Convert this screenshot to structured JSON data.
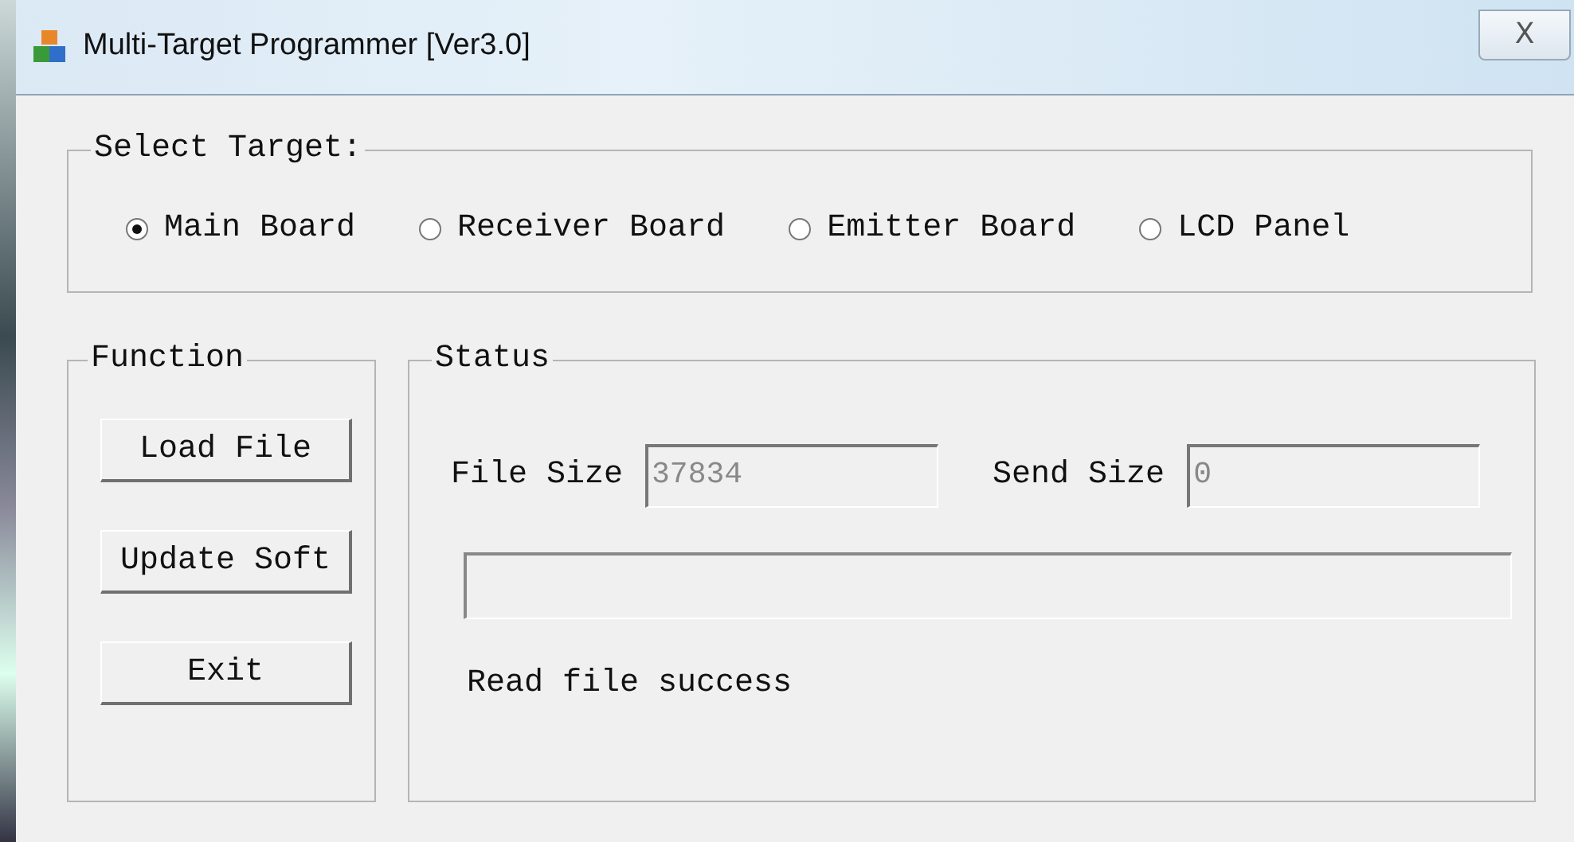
{
  "window": {
    "title": "Multi-Target Programmer [Ver3.0]",
    "close": "X"
  },
  "select_target": {
    "title": "Select Target:",
    "options": [
      {
        "label": "Main Board",
        "selected": true
      },
      {
        "label": "Receiver Board",
        "selected": false
      },
      {
        "label": "Emitter Board",
        "selected": false
      },
      {
        "label": "LCD Panel",
        "selected": false
      }
    ]
  },
  "function": {
    "title": "Function",
    "buttons": [
      "Load File",
      "Update Soft",
      "Exit"
    ]
  },
  "status": {
    "title": "Status",
    "fields": [
      {
        "label": "File Size",
        "value": "37834"
      },
      {
        "label": "Send Size",
        "value": "0"
      }
    ],
    "progress": {
      "level": 0
    },
    "message": "Read file success"
  }
}
